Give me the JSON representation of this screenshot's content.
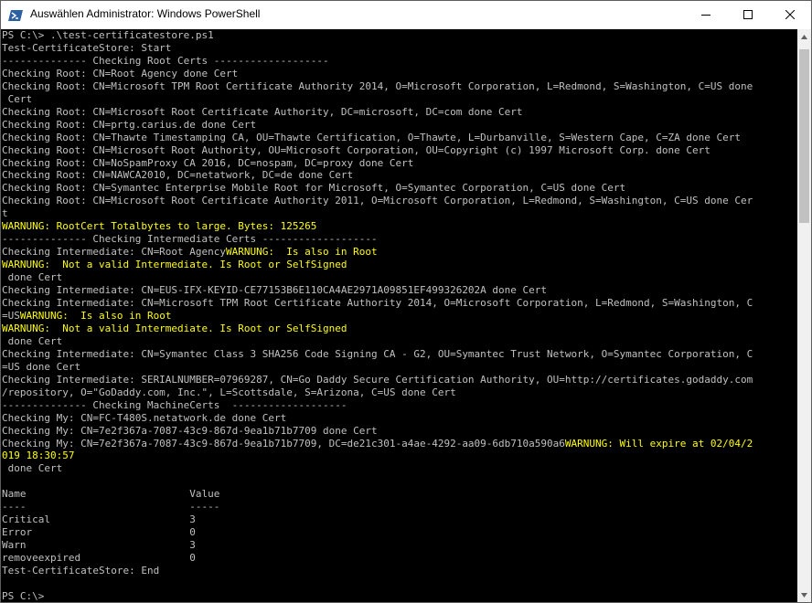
{
  "window": {
    "title": "Auswählen Administrator: Windows PowerShell"
  },
  "icons": {
    "app": "powershell-icon",
    "minimize": "minimize-icon",
    "maximize": "maximize-icon",
    "close": "close-icon",
    "scroll_up": "arrow-up-icon",
    "scroll_down": "arrow-down-icon"
  },
  "colors": {
    "console_bg": "#000000",
    "console_text": "#c0c0c0",
    "warning_text": "#ffff00",
    "titlebar_bg": "#ffffff"
  },
  "console": {
    "lines": [
      [
        {
          "t": "PS C:\\> .\\test-certificatestore.ps1"
        }
      ],
      [
        {
          "t": "Test-CertificateStore: Start"
        }
      ],
      [
        {
          "t": "-------------- Checking Root Certs -------------------"
        }
      ],
      [
        {
          "t": "Checking Root: CN=Root Agency done Cert"
        }
      ],
      [
        {
          "t": "Checking Root: CN=Microsoft TPM Root Certificate Authority 2014, O=Microsoft Corporation, L=Redmond, S=Washington, C=US done"
        }
      ],
      [
        {
          "t": " Cert"
        }
      ],
      [
        {
          "t": "Checking Root: CN=Microsoft Root Certificate Authority, DC=microsoft, DC=com done Cert"
        }
      ],
      [
        {
          "t": "Checking Root: CN=prtg.carius.de done Cert"
        }
      ],
      [
        {
          "t": "Checking Root: CN=Thawte Timestamping CA, OU=Thawte Certification, O=Thawte, L=Durbanville, S=Western Cape, C=ZA done Cert"
        }
      ],
      [
        {
          "t": "Checking Root: CN=Microsoft Root Authority, OU=Microsoft Corporation, OU=Copyright (c) 1997 Microsoft Corp. done Cert"
        }
      ],
      [
        {
          "t": "Checking Root: CN=NoSpamProxy CA 2016, DC=nospam, DC=proxy done Cert"
        }
      ],
      [
        {
          "t": "Checking Root: CN=NAWCA2010, DC=netatwork, DC=de done Cert"
        }
      ],
      [
        {
          "t": "Checking Root: CN=Symantec Enterprise Mobile Root for Microsoft, O=Symantec Corporation, C=US done Cert"
        }
      ],
      [
        {
          "t": "Checking Root: CN=Microsoft Root Certificate Authority 2011, O=Microsoft Corporation, L=Redmond, S=Washington, C=US done Cer"
        }
      ],
      [
        {
          "t": "t"
        }
      ],
      [
        {
          "t": "WARNUNG: RootCert Totalbytes to large. Bytes: 125265",
          "w": true
        }
      ],
      [
        {
          "t": "-------------- Checking Intermediate Certs -------------------"
        }
      ],
      [
        {
          "t": "Checking Intermediate: CN=Root Agency"
        },
        {
          "t": "WARNUNG:  Is also in Root",
          "w": true
        }
      ],
      [
        {
          "t": "WARNUNG:  Not a valid Intermediate. Is Root or SelfSigned",
          "w": true
        }
      ],
      [
        {
          "t": " done Cert"
        }
      ],
      [
        {
          "t": "Checking Intermediate: CN=EUS-IFX-KEYID-CE77153B6E110CA4AE2971A09851EF499326202A done Cert"
        }
      ],
      [
        {
          "t": "Checking Intermediate: CN=Microsoft TPM Root Certificate Authority 2014, O=Microsoft Corporation, L=Redmond, S=Washington, C"
        }
      ],
      [
        {
          "t": "=US"
        },
        {
          "t": "WARNUNG:  Is also in Root",
          "w": true
        }
      ],
      [
        {
          "t": "WARNUNG:  Not a valid Intermediate. Is Root or SelfSigned",
          "w": true
        }
      ],
      [
        {
          "t": " done Cert"
        }
      ],
      [
        {
          "t": "Checking Intermediate: CN=Symantec Class 3 SHA256 Code Signing CA - G2, OU=Symantec Trust Network, O=Symantec Corporation, C"
        }
      ],
      [
        {
          "t": "=US done Cert"
        }
      ],
      [
        {
          "t": "Checking Intermediate: SERIALNUMBER=07969287, CN=Go Daddy Secure Certification Authority, OU=http://certificates.godaddy.com"
        }
      ],
      [
        {
          "t": "/repository, O=\"GoDaddy.com, Inc.\", L=Scottsdale, S=Arizona, C=US done Cert"
        }
      ],
      [
        {
          "t": "-------------- Checking MachineCerts  -------------------"
        }
      ],
      [
        {
          "t": "Checking My: CN=FC-T480S.netatwork.de done Cert"
        }
      ],
      [
        {
          "t": "Checking My: CN=7e2f367a-7087-43c9-867d-9ea1b71b7709 done Cert"
        }
      ],
      [
        {
          "t": "Checking My: CN=7e2f367a-7087-43c9-867d-9ea1b71b7709, DC=de21c301-a4ae-4292-aa09-6db710a590a6"
        },
        {
          "t": "WARNUNG: Will expire at 02/04/2",
          "w": true
        }
      ],
      [
        {
          "t": "019 18:30:57",
          "w": true
        }
      ],
      [
        {
          "t": " done Cert"
        }
      ],
      [
        {
          "t": ""
        }
      ],
      [
        {
          "t": "Name                           Value"
        }
      ],
      [
        {
          "t": "----                           -----"
        }
      ],
      [
        {
          "t": "Critical                       3"
        }
      ],
      [
        {
          "t": "Error                          0"
        }
      ],
      [
        {
          "t": "Warn                           3"
        }
      ],
      [
        {
          "t": "removeexpired                  0"
        }
      ],
      [
        {
          "t": "Test-CertificateStore: End"
        }
      ],
      [
        {
          "t": ""
        }
      ],
      [
        {
          "t": "PS C:\\>"
        }
      ]
    ]
  }
}
